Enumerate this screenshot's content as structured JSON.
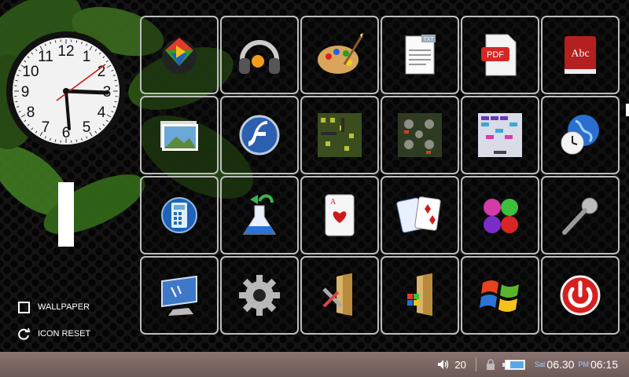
{
  "clock": {
    "numbers": [
      "12",
      "1",
      "2",
      "3",
      "4",
      "5",
      "6",
      "7",
      "8",
      "9",
      "10",
      "11"
    ]
  },
  "big_digit": "1",
  "side_actions": {
    "wallpaper_label": "WALLPAPER",
    "icon_reset_label": "ICON RESET"
  },
  "icons": [
    [
      "media-player-icon",
      "headphones-icon",
      "paint-palette-icon",
      "text-document-icon",
      "pdf-document-icon",
      "dictionary-icon"
    ],
    [
      "photo-gallery-icon",
      "flash-icon",
      "maze-game-icon",
      "ninja-game-icon",
      "brick-game-icon",
      "world-clock-icon"
    ],
    [
      "calculator-icon",
      "flask-icon",
      "ace-card-icon",
      "card-game-icon",
      "bubbles-game-icon",
      "microphone-icon"
    ],
    [
      "desktop-settings-icon",
      "gear-icon",
      "folder-tools-icon",
      "folder-apps-icon",
      "windows-logo-icon",
      "power-icon"
    ]
  ],
  "tiles_badges": {
    "pdf": "PDF",
    "txt": "TXT",
    "abc": "Abc",
    "ace": "A"
  },
  "taskbar": {
    "volume": "20",
    "day": "Sat",
    "date": "06.30",
    "ampm": "PM",
    "time": "06:15"
  },
  "colors": {
    "accent_blue": "#5aa9e6",
    "power_red": "#d81e1e",
    "taskbar": "#7d6966"
  }
}
